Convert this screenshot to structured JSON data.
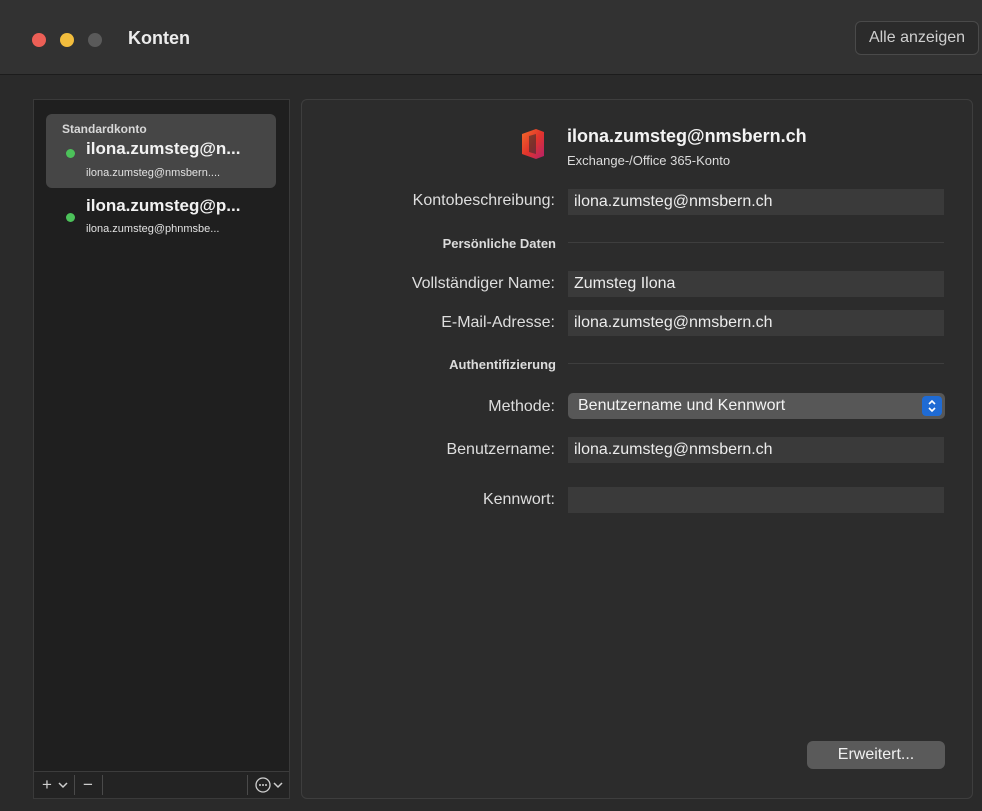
{
  "window": {
    "title": "Konten",
    "show_all_label": "Alle anzeigen"
  },
  "sidebar": {
    "accounts": [
      {
        "group_label": "Standardkonto",
        "name": "ilona.zumsteg@n...",
        "email": "ilona.zumsteg@nmsbern....",
        "selected": true,
        "status_color": "#4cc25a"
      },
      {
        "name": "ilona.zumsteg@p...",
        "email": "ilona.zumsteg@phnmsbe...",
        "selected": false,
        "status_color": "#4cc25a"
      }
    ],
    "toolbar": {
      "add_label": "+",
      "add_menu_label": "⌄",
      "remove_label": "−",
      "more_label": "⋯"
    }
  },
  "detail": {
    "account_title": "ilona.zumsteg@nmsbern.ch",
    "account_type": "Exchange-/Office 365-Konto",
    "description_label": "Kontobeschreibung:",
    "description_value": "ilona.zumsteg@nmsbern.ch",
    "personal_section": "Persönliche Daten",
    "fullname_label": "Vollständiger Name:",
    "fullname_value": "Zumsteg Ilona",
    "email_label": "E-Mail-Adresse:",
    "email_value": "ilona.zumsteg@nmsbern.ch",
    "auth_section": "Authentifizierung",
    "method_label": "Methode:",
    "method_value": "Benutzername und Kennwort",
    "username_label": "Benutzername:",
    "username_value": "ilona.zumsteg@nmsbern.ch",
    "password_label": "Kennwort:",
    "password_value": "",
    "advanced_label": "Erweitert..."
  },
  "colors": {
    "accent": "#1f6bd4",
    "status_online": "#4cc25a"
  }
}
